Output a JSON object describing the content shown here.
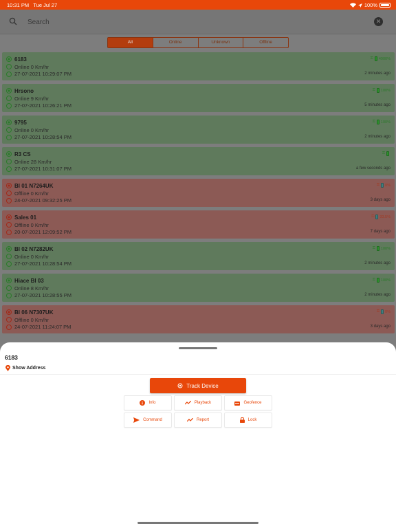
{
  "status_bar": {
    "time": "10:31 PM",
    "date": "Tue Jul 27",
    "battery": "100%"
  },
  "search": {
    "placeholder": "Search"
  },
  "filters": [
    "All",
    "Online",
    "Unknown",
    "Offline"
  ],
  "colors": {
    "accent": "#e8470a",
    "online": "#5f7a5c",
    "offline": "#8c5a55"
  },
  "devices": [
    {
      "name": "6183",
      "speed": "Online 0 Km/hr",
      "time": "27-07-2021 10:29:07 PM",
      "ago": "2 minutes ago",
      "battery": "4000%",
      "status": "online"
    },
    {
      "name": "Hrsono",
      "speed": "Online 9 Km/hr",
      "time": "27-07-2021 10:26:21 PM",
      "ago": "5 minutes ago",
      "battery": "100%",
      "status": "online"
    },
    {
      "name": "9795",
      "speed": "Online 0 Km/hr",
      "time": "27-07-2021 10:28:54 PM",
      "ago": "2 minutes ago",
      "battery": "100%",
      "status": "online"
    },
    {
      "name": "R3 CS",
      "speed": "Online 28 Km/hr",
      "time": "27-07-2021 10:31:07 PM",
      "ago": "a few seconds ago",
      "battery": "",
      "status": "online"
    },
    {
      "name": "BI 01 N7264UK",
      "speed": "Offline 0 Km/hr",
      "time": "24-07-2021 09:32:25 PM",
      "ago": "3 days ago",
      "battery": "0%",
      "status": "offline"
    },
    {
      "name": "Sales 01",
      "speed": "Offline 0 Km/hr",
      "time": "20-07-2021 12:09:52 PM",
      "ago": "7 days ago",
      "battery": "33.5%",
      "status": "offline"
    },
    {
      "name": "BI 02 N7282UK",
      "speed": "Online 0 Km/hr",
      "time": "27-07-2021 10:28:54 PM",
      "ago": "2 minutes ago",
      "battery": "100%",
      "status": "online"
    },
    {
      "name": "Hiace BI 03",
      "speed": "Online 8 Km/hr",
      "time": "27-07-2021 10:28:55 PM",
      "ago": "2 minutes ago",
      "battery": "100%",
      "status": "online"
    },
    {
      "name": "BI 06 N7307UK",
      "speed": "Offline 0 Km/hr",
      "time": "24-07-2021 11:24:07 PM",
      "ago": "3 days ago",
      "battery": "0%",
      "status": "offline"
    }
  ],
  "sheet": {
    "device_name": "6183",
    "show_address": "Show Address",
    "track_label": "Track Device",
    "actions": [
      "Info",
      "Playback",
      "Geofence",
      "Command",
      "Report",
      "Lock"
    ]
  }
}
